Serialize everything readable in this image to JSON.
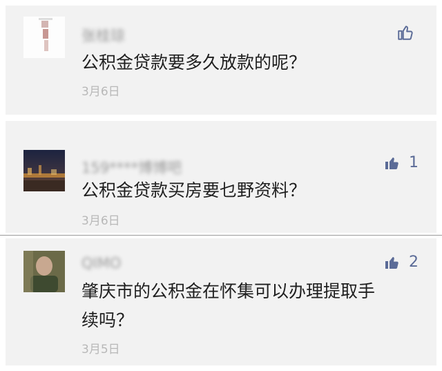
{
  "comments": [
    {
      "username": "张桂琼",
      "text_lines": [
        "公积金贷款要多久放款的呢？"
      ],
      "date": "3月6日",
      "likes": "",
      "avatar": "avatar-white-figure"
    },
    {
      "username": "159****博博吧",
      "text_lines": [
        "公积金贷款买房要乜野资料？"
      ],
      "date": "3月6日",
      "likes": "1",
      "avatar": "avatar-night-city"
    },
    {
      "username": "QIMO",
      "text_lines": [
        "肇庆市的公积金在怀集可以办理提取手",
        "续吗？"
      ],
      "date": "3月5日",
      "likes": "2",
      "avatar": "avatar-person-photo"
    }
  ],
  "colors": {
    "card_bg": "#f2f2f2",
    "text": "#1f1f1f",
    "date": "#b8b8b8",
    "like_icon": "#5b6b97"
  }
}
